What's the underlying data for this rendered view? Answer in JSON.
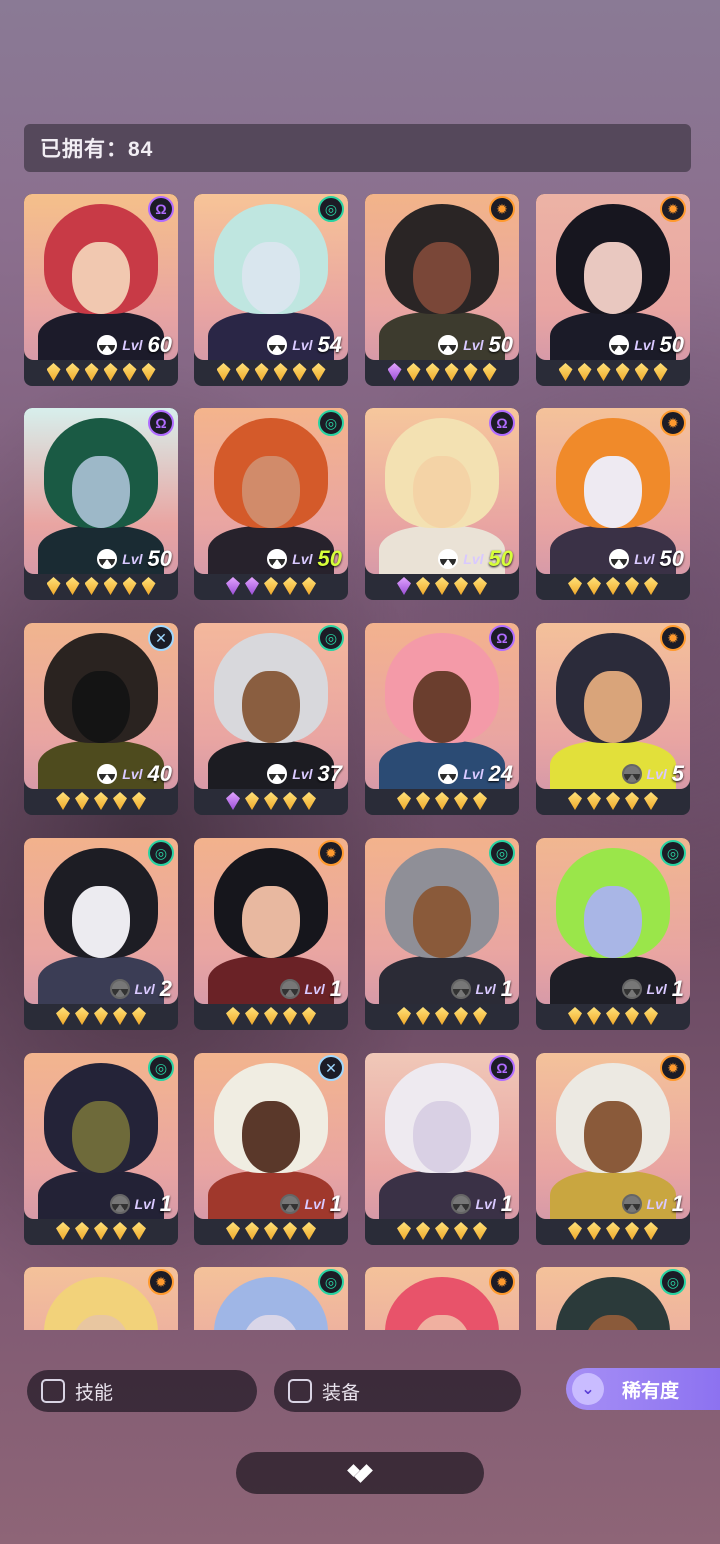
{
  "header": {
    "owned_label": "已拥有：84"
  },
  "colors": {
    "faction_psi": "#b06cff",
    "faction_swirl": "#29d3a2",
    "faction_sun": "#ff9a2e",
    "faction_cross": "#9fd8ff",
    "gem_gold": "#f3b534",
    "gem_purple": "#b56cf0",
    "accent": "#9c84f3"
  },
  "cards": [
    {
      "faction": "psi-icon",
      "glyph": "Ω",
      "level": "60",
      "lvl_prefix": "Lvl",
      "skill": "lit",
      "stars": [
        "g",
        "g",
        "g",
        "g",
        "g",
        "g"
      ],
      "pal": [
        "#f5c08a",
        "#c83a46",
        "#f1c8b0",
        "#1c1b2a"
      ],
      "lime": false
    },
    {
      "faction": "swirl-icon",
      "glyph": "◎",
      "level": "54",
      "lvl_prefix": "Lvl",
      "skill": "lit",
      "stars": [
        "g",
        "g",
        "g",
        "g",
        "g",
        "g"
      ],
      "pal": [
        "#f7c497",
        "#bfe6e0",
        "#d9e6ee",
        "#2a2646"
      ],
      "lime": false
    },
    {
      "faction": "sun-icon",
      "glyph": "✹",
      "level": "50",
      "lvl_prefix": "Lvl",
      "skill": "lit",
      "stars": [
        "p",
        "g",
        "g",
        "g",
        "g",
        "g"
      ],
      "pal": [
        "#f2b489",
        "#2a2525",
        "#7a4738",
        "#3d3b2e"
      ],
      "lime": false
    },
    {
      "faction": "sun-icon",
      "glyph": "✹",
      "level": "50",
      "lvl_prefix": "Lvl",
      "skill": "lit",
      "stars": [
        "g",
        "g",
        "g",
        "g",
        "g",
        "g"
      ],
      "pal": [
        "#ecb3a5",
        "#17161f",
        "#e9c8c0",
        "#1b1b28"
      ],
      "lime": false
    },
    {
      "faction": "psi-icon",
      "glyph": "Ω",
      "level": "50",
      "lvl_prefix": "Lvl",
      "skill": "lit",
      "stars": [
        "g",
        "g",
        "g",
        "g",
        "g",
        "g"
      ],
      "pal": [
        "#d7efec",
        "#1a5a44",
        "#9db8c8",
        "#1a2b33"
      ],
      "lime": false
    },
    {
      "faction": "swirl-icon",
      "glyph": "◎",
      "level": "50",
      "lvl_prefix": "Lvl",
      "skill": "lit",
      "stars": [
        "p",
        "p",
        "g",
        "g",
        "g"
      ],
      "pal": [
        "#f4b48c",
        "#d45a2a",
        "#d18b6a",
        "#27222c"
      ],
      "lime": true
    },
    {
      "faction": "psi-icon",
      "glyph": "Ω",
      "level": "50",
      "lvl_prefix": "Lvl",
      "skill": "lit",
      "stars": [
        "p",
        "g",
        "g",
        "g",
        "g"
      ],
      "pal": [
        "#f6c79c",
        "#f3e1b2",
        "#f4d3a6",
        "#eae2d6"
      ],
      "lime": true
    },
    {
      "faction": "sun-icon",
      "glyph": "✹",
      "level": "50",
      "lvl_prefix": "Lvl",
      "skill": "lit",
      "stars": [
        "g",
        "g",
        "g",
        "g",
        "g"
      ],
      "pal": [
        "#f4c29a",
        "#f08a2a",
        "#eeeaf2",
        "#3a3146"
      ],
      "lime": false
    },
    {
      "faction": "cross-icon",
      "glyph": "✕",
      "level": "40",
      "lvl_prefix": "Lvl",
      "skill": "lit",
      "stars": [
        "g",
        "g",
        "g",
        "g",
        "g"
      ],
      "pal": [
        "#f1b58e",
        "#2a2320",
        "#141414",
        "#4e4b1e"
      ],
      "lime": false
    },
    {
      "faction": "swirl-icon",
      "glyph": "◎",
      "level": "37",
      "lvl_prefix": "Lvl",
      "skill": "lit",
      "stars": [
        "p",
        "g",
        "g",
        "g",
        "g"
      ],
      "pal": [
        "#f4b89c",
        "#d8d8dc",
        "#8a5e40",
        "#1c1c22"
      ],
      "lime": false
    },
    {
      "faction": "psi-icon",
      "glyph": "Ω",
      "level": "24",
      "lvl_prefix": "Lvl",
      "skill": "lit",
      "stars": [
        "g",
        "g",
        "g",
        "g",
        "g"
      ],
      "pal": [
        "#f3b28e",
        "#f49aa8",
        "#6b3e2e",
        "#2b4b74"
      ],
      "lime": false
    },
    {
      "faction": "sun-icon",
      "glyph": "✹",
      "level": "5",
      "lvl_prefix": "Lvl",
      "skill": "dim",
      "stars": [
        "g",
        "g",
        "g",
        "g",
        "g"
      ],
      "pal": [
        "#f4c19a",
        "#2b2b3a",
        "#d9a47a",
        "#e2e03a"
      ],
      "lime": false
    },
    {
      "faction": "swirl-icon",
      "glyph": "◎",
      "level": "2",
      "lvl_prefix": "Lvl",
      "skill": "dim",
      "stars": [
        "g",
        "g",
        "g",
        "g",
        "g"
      ],
      "pal": [
        "#f2b28c",
        "#1d1d24",
        "#ecebf0",
        "#3b3d55"
      ],
      "lime": false
    },
    {
      "faction": "sun-icon",
      "glyph": "✹",
      "level": "1",
      "lvl_prefix": "Lvl",
      "skill": "dim",
      "stars": [
        "g",
        "g",
        "g",
        "g",
        "g"
      ],
      "pal": [
        "#f2b28c",
        "#16161c",
        "#e8b8a0",
        "#6a2226"
      ],
      "lime": false
    },
    {
      "faction": "swirl-icon",
      "glyph": "◎",
      "level": "1",
      "lvl_prefix": "Lvl",
      "skill": "dim",
      "stars": [
        "g",
        "g",
        "g",
        "g",
        "g"
      ],
      "pal": [
        "#f3b38c",
        "#8f8f97",
        "#8a5a3a",
        "#2b2b36"
      ],
      "lime": false
    },
    {
      "faction": "swirl-icon",
      "glyph": "◎",
      "level": "1",
      "lvl_prefix": "Lvl",
      "skill": "dim",
      "stars": [
        "g",
        "g",
        "g",
        "g",
        "g"
      ],
      "pal": [
        "#f1b790",
        "#9ae64a",
        "#a9b6e6",
        "#1e1e26"
      ],
      "lime": false
    },
    {
      "faction": "swirl-icon",
      "glyph": "◎",
      "level": "1",
      "lvl_prefix": "Lvl",
      "skill": "dim",
      "stars": [
        "g",
        "g",
        "g",
        "g",
        "g"
      ],
      "pal": [
        "#f3b58e",
        "#242338",
        "#6e6a3a",
        "#232236"
      ],
      "lime": false
    },
    {
      "faction": "cross-icon",
      "glyph": "✕",
      "level": "1",
      "lvl_prefix": "Lvl",
      "skill": "dim",
      "stars": [
        "g",
        "g",
        "g",
        "g",
        "g"
      ],
      "pal": [
        "#f3b58e",
        "#f0ede2",
        "#5a382a",
        "#a0382c"
      ],
      "lime": false
    },
    {
      "faction": "psi-icon",
      "glyph": "Ω",
      "level": "1",
      "lvl_prefix": "Lvl",
      "skill": "dim",
      "stars": [
        "g",
        "g",
        "g",
        "g",
        "g"
      ],
      "pal": [
        "#f0c8b8",
        "#eeeaf0",
        "#d9d0e4",
        "#3a3146"
      ],
      "lime": false
    },
    {
      "faction": "sun-icon",
      "glyph": "✹",
      "level": "1",
      "lvl_prefix": "Lvl",
      "skill": "dim",
      "stars": [
        "g",
        "g",
        "g",
        "g",
        "g"
      ],
      "pal": [
        "#f4c29a",
        "#ece9e2",
        "#8a5a3a",
        "#c9a640"
      ],
      "lime": false
    },
    {
      "faction": "sun-icon",
      "glyph": "✹",
      "level": "",
      "lvl_prefix": "",
      "skill": "none",
      "stars": [],
      "pal": [
        "#f4c29a",
        "#f2d27a",
        "#e8c6a0",
        "#6e5a3a"
      ],
      "lime": false
    },
    {
      "faction": "swirl-icon",
      "glyph": "◎",
      "level": "",
      "lvl_prefix": "",
      "skill": "none",
      "stars": [],
      "pal": [
        "#f4c29a",
        "#9fb6e6",
        "#d9d6e8",
        "#3a3146"
      ],
      "lime": false
    },
    {
      "faction": "sun-icon",
      "glyph": "✹",
      "level": "",
      "lvl_prefix": "",
      "skill": "none",
      "stars": [],
      "pal": [
        "#f4c29a",
        "#e8536a",
        "#f0b0a0",
        "#6a2a3a"
      ],
      "lime": false
    },
    {
      "faction": "swirl-icon",
      "glyph": "◎",
      "level": "",
      "lvl_prefix": "",
      "skill": "none",
      "stars": [],
      "pal": [
        "#f4c29a",
        "#2b3a3a",
        "#8a5a3a",
        "#1e1e26"
      ],
      "lime": false
    }
  ],
  "filters": {
    "skill_label": "技能",
    "equip_label": "装备",
    "rarity_label": "稀有度"
  }
}
